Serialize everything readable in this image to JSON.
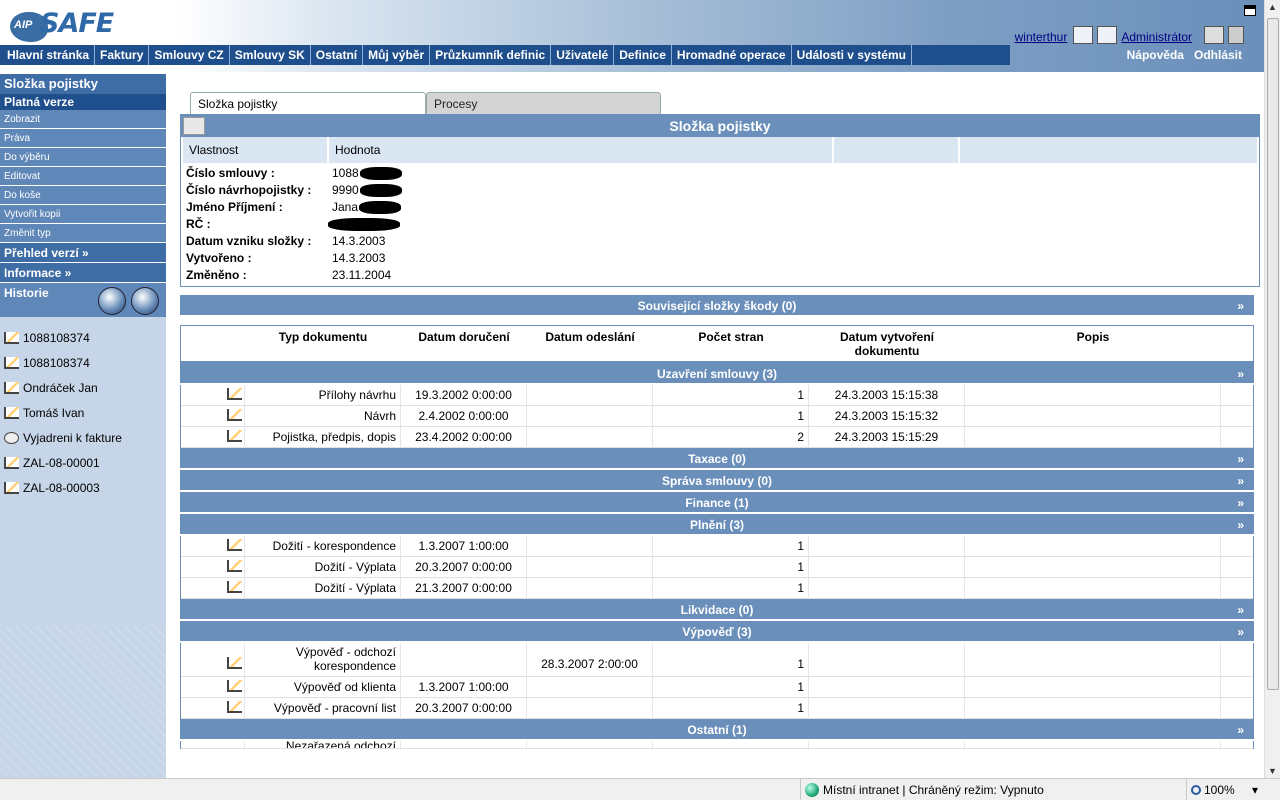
{
  "header": {
    "logo_prefix": "AIP",
    "logo_text": "SAFE",
    "user_link": "winterthur",
    "user_role": "Administrátor",
    "help": "Nápověda",
    "logout": "Odhlásit"
  },
  "nav": [
    "Hlavní stránka",
    "Faktury",
    "Smlouvy CZ",
    "Smlouvy SK",
    "Ostatní",
    "Můj výběr",
    "Průzkumník definic",
    "Uživatelé",
    "Definice",
    "Hromadné operace",
    "Události v systému"
  ],
  "sidebar": {
    "title": "Složka pojistky",
    "section": "Platná verze",
    "links": [
      "Zobrazit",
      "Práva",
      "Do výběru",
      "Editovat",
      "Do koše",
      "Vytvořit kopii",
      "Změnit typ"
    ],
    "version_overview": "Přehled verzí »",
    "info": "Informace »",
    "history_title": "Historie",
    "history": [
      "1088108374",
      "1088108374",
      "Ondráček Jan",
      "Tomáš Ivan",
      "Vyjadreni k fakture",
      "ZAL-08-00001",
      "ZAL-08-00003"
    ]
  },
  "tabs": [
    "Složka pojistky",
    "Procesy"
  ],
  "panel": {
    "title": "Složka pojistky",
    "col_property": "Vlastnost",
    "col_value": "Hodnota",
    "props": [
      {
        "k": "Číslo smlouvy :",
        "v": "1088"
      },
      {
        "k": "Číslo návrhopojistky :",
        "v": "9990"
      },
      {
        "k": "Jméno Příjmení :",
        "v": "Jana"
      },
      {
        "k": "RČ :",
        "v": ""
      },
      {
        "k": "Datum vzniku složky :",
        "v": "14.3.2003"
      },
      {
        "k": "Vytvořeno :",
        "v": "14.3.2003"
      },
      {
        "k": "Změněno :",
        "v": "23.11.2004"
      }
    ]
  },
  "related": "Související složky škody (0)",
  "doc_headers": [
    "Typ dokumentu",
    "Datum doručení",
    "Datum odeslání",
    "Počet stran",
    "Datum vytvoření dokumentu",
    "Popis"
  ],
  "groups": [
    {
      "title": "Uzavření smlouvy (3)",
      "rows": [
        {
          "type": "Přílohy návrhu",
          "recv": "19.3.2002 0:00:00",
          "sent": "",
          "pages": "1",
          "created": "24.3.2003 15:15:38"
        },
        {
          "type": "Návrh",
          "recv": "2.4.2002 0:00:00",
          "sent": "",
          "pages": "1",
          "created": "24.3.2003 15:15:32"
        },
        {
          "type": "Pojistka, předpis, dopis",
          "recv": "23.4.2002 0:00:00",
          "sent": "",
          "pages": "2",
          "created": "24.3.2003 15:15:29"
        }
      ]
    },
    {
      "title": "Taxace (0)",
      "rows": []
    },
    {
      "title": "Správa smlouvy (0)",
      "rows": []
    },
    {
      "title": "Finance (1)",
      "rows": []
    },
    {
      "title": "Plnění (3)",
      "rows": [
        {
          "type": "Dožití - korespondence",
          "recv": "1.3.2007 1:00:00",
          "sent": "",
          "pages": "1",
          "created": ""
        },
        {
          "type": "Dožití - Výplata",
          "recv": "20.3.2007 0:00:00",
          "sent": "",
          "pages": "1",
          "created": ""
        },
        {
          "type": "Dožití - Výplata",
          "recv": "21.3.2007 0:00:00",
          "sent": "",
          "pages": "1",
          "created": ""
        }
      ]
    },
    {
      "title": "Likvidace (0)",
      "rows": []
    },
    {
      "title": "Výpověď (3)",
      "rows": [
        {
          "type": "Výpověď - odchozí korespondence",
          "recv": "",
          "sent": "28.3.2007 2:00:00",
          "pages": "1",
          "created": "",
          "tall": true
        },
        {
          "type": "Výpověď od klienta",
          "recv": "1.3.2007 1:00:00",
          "sent": "",
          "pages": "1",
          "created": ""
        },
        {
          "type": "Výpověď - pracovní list",
          "recv": "20.3.2007 0:00:00",
          "sent": "",
          "pages": "1",
          "created": ""
        }
      ]
    },
    {
      "title": "Ostatní (1)",
      "rows": [
        {
          "type": "Nezařazená odchozí",
          "recv": "",
          "sent": "",
          "pages": "",
          "created": "",
          "cut": true
        }
      ]
    }
  ],
  "statusbar": {
    "zone": "Místní intranet | Chráněný režim: Vypnuto",
    "zoom": "100%"
  }
}
